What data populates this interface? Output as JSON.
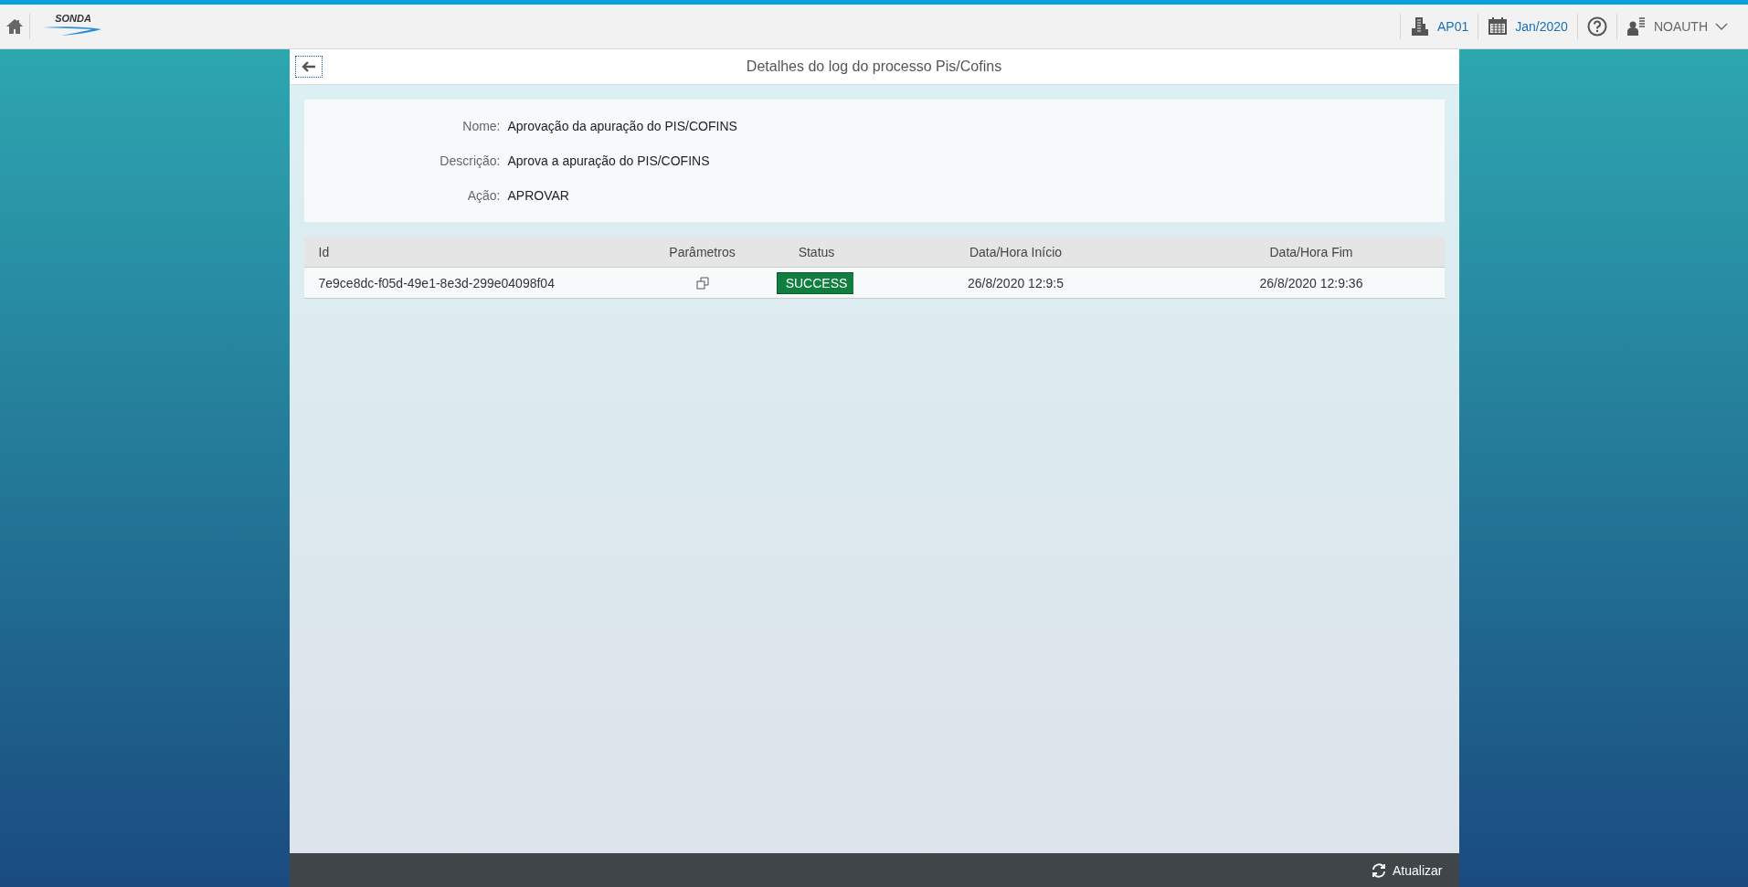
{
  "topbar": {
    "logo": "SONDA",
    "company": "AP01",
    "period": "Jan/2020",
    "user": "NOAUTH"
  },
  "page": {
    "title": "Detalhes do log do processo Pis/Cofins"
  },
  "details": [
    {
      "label": "Nome:",
      "value": "Aprovação da apuração do PIS/COFINS"
    },
    {
      "label": "Descrição:",
      "value": "Aprova a apuração do PIS/COFINS"
    },
    {
      "label": "Ação:",
      "value": "APROVAR"
    }
  ],
  "table": {
    "columns": [
      "Id",
      "Parâmetros",
      "Status",
      "Data/Hora Início",
      "Data/Hora Fim"
    ],
    "rows": [
      {
        "id": "7e9ce8dc-f05d-49e1-8e3d-299e04098f04",
        "status": {
          "label": "SUCCESS",
          "kind": "success"
        },
        "start": "26/8/2020 12:9:5",
        "end": "26/8/2020 12:9:36"
      }
    ]
  },
  "footer": {
    "refresh": "Atualizar"
  }
}
